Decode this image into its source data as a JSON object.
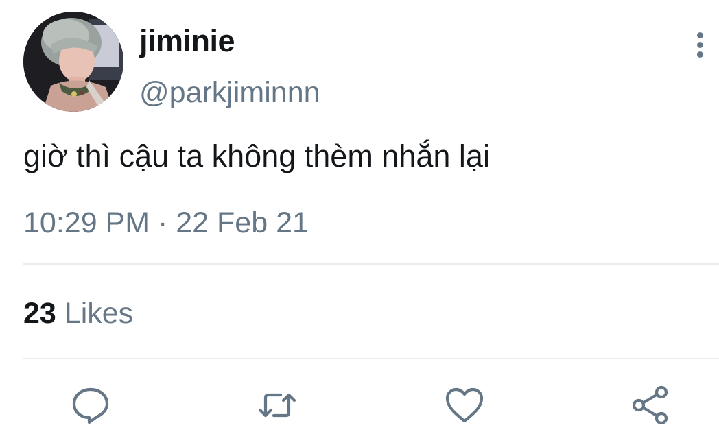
{
  "author": {
    "display_name": "jiminie",
    "handle": "@parkjiminnn"
  },
  "tweet": {
    "text": "giờ thì cậu ta không thèm nhắn lại",
    "timestamp": "10:29 PM · 22 Feb 21"
  },
  "stats": {
    "likes_count": "23",
    "likes_label": "Likes"
  },
  "icons": {
    "more": "more-vertical-icon",
    "reply": "reply-icon",
    "retweet": "retweet-icon",
    "like": "heart-icon",
    "share": "share-icon"
  },
  "colors": {
    "text_primary": "#14171a",
    "text_secondary": "#657786",
    "divider": "#e6ecf0",
    "background": "#ffffff"
  }
}
